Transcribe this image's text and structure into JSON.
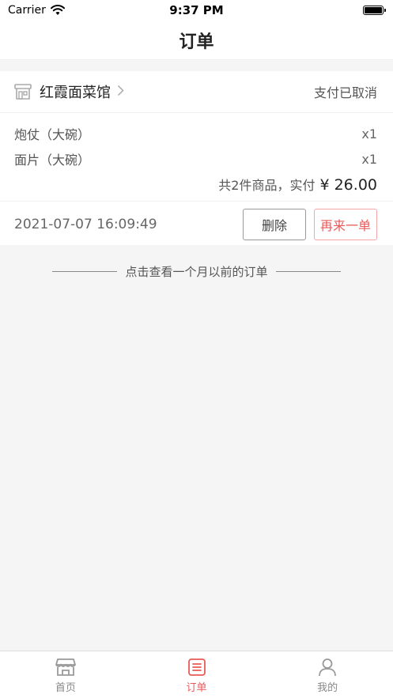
{
  "status_bar": {
    "carrier": "Carrier",
    "time": "9:37 PM"
  },
  "nav": {
    "title": "订单"
  },
  "order": {
    "shop_name": "红霞面菜馆",
    "status": "支付已取消",
    "items": [
      {
        "name": "炮仗（大碗）",
        "qty": "x1"
      },
      {
        "name": "面片（大碗）",
        "qty": "x1"
      }
    ],
    "total_label": "共2件商品，实付",
    "total_price": "¥ 26.00",
    "time": "2021-07-07 16:09:49",
    "delete_label": "删除",
    "reorder_label": "再来一单"
  },
  "history": {
    "label": "点击查看一个月以前的订单"
  },
  "tabs": [
    {
      "label": "首页",
      "icon": "shop-icon"
    },
    {
      "label": "订单",
      "icon": "order-list-icon",
      "active": true
    },
    {
      "label": "我的",
      "icon": "user-icon"
    }
  ],
  "colors": {
    "accent": "#e85a5a",
    "background": "#f5f5f5"
  }
}
